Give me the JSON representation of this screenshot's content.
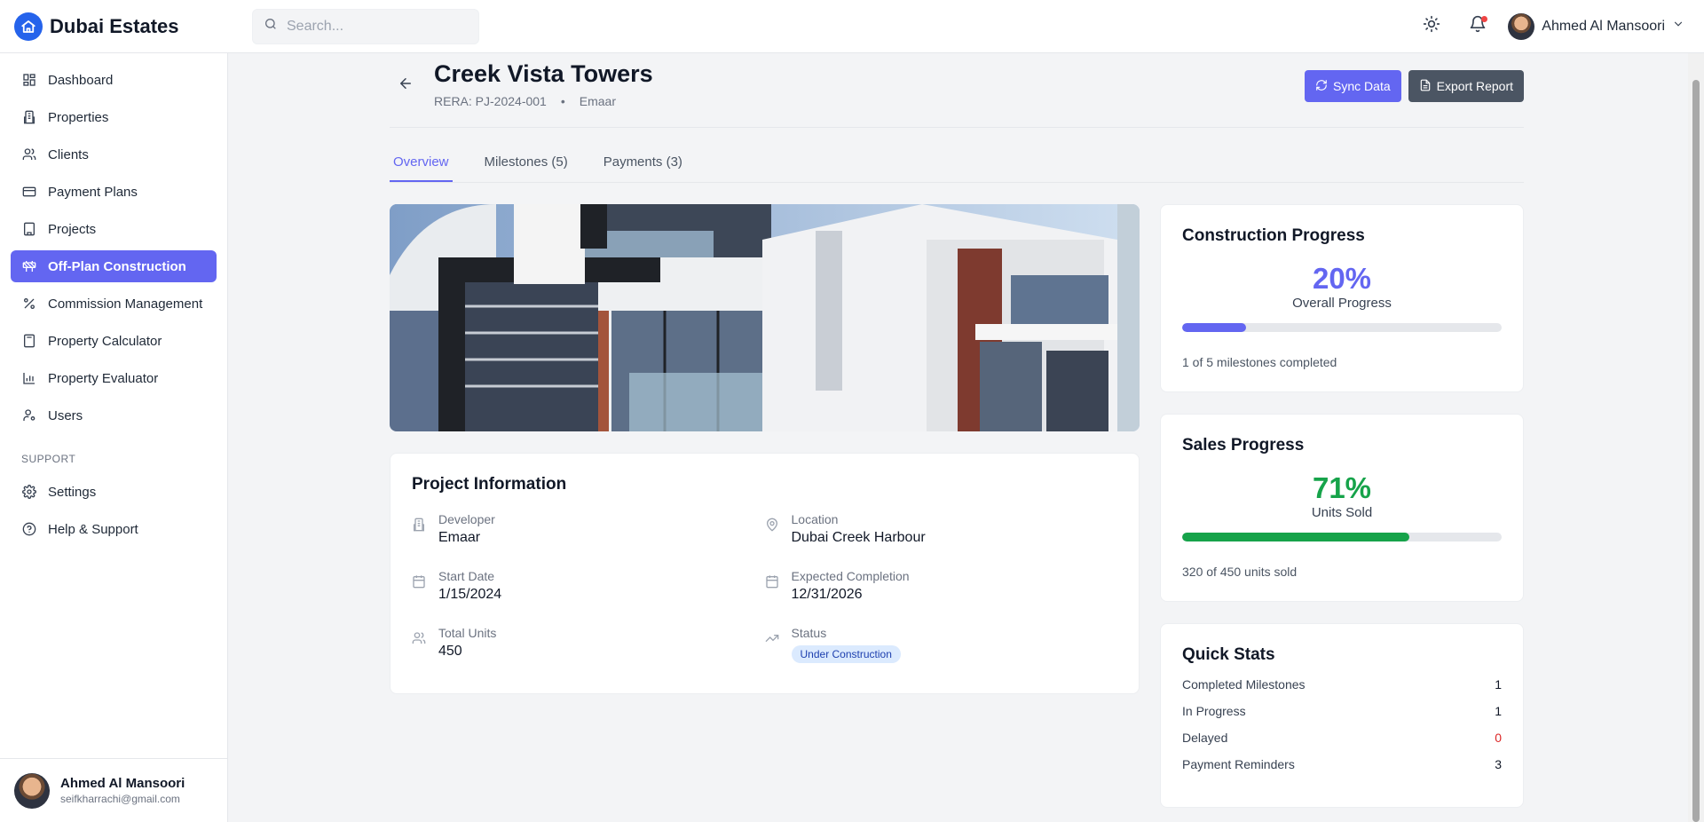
{
  "app": {
    "name": "Dubai Estates"
  },
  "header": {
    "search_placeholder": "Search...",
    "user_name": "Ahmed Al Mansoori"
  },
  "sidebar": {
    "items": [
      {
        "label": "Dashboard",
        "icon": "dashboard-icon"
      },
      {
        "label": "Properties",
        "icon": "building-icon"
      },
      {
        "label": "Clients",
        "icon": "users-icon"
      },
      {
        "label": "Payment Plans",
        "icon": "credit-card-icon"
      },
      {
        "label": "Projects",
        "icon": "office-icon"
      },
      {
        "label": "Off-Plan Construction",
        "icon": "construction-icon",
        "active": true
      },
      {
        "label": "Commission Management",
        "icon": "percent-icon"
      },
      {
        "label": "Property Calculator",
        "icon": "calculator-icon"
      },
      {
        "label": "Property Evaluator",
        "icon": "bar-chart-icon"
      },
      {
        "label": "Users",
        "icon": "user-key-icon"
      }
    ],
    "support_label": "SUPPORT",
    "support_items": [
      {
        "label": "Settings",
        "icon": "gear-icon"
      },
      {
        "label": "Help & Support",
        "icon": "help-icon"
      }
    ],
    "footer": {
      "name": "Ahmed Al Mansoori",
      "email": "seifkharrachi@gmail.com"
    }
  },
  "project": {
    "title": "Creek Vista Towers",
    "rera": "RERA: PJ-2024-001",
    "separator": "•",
    "developer_short": "Emaar",
    "actions": {
      "sync": "Sync Data",
      "export": "Export Report"
    }
  },
  "tabs": [
    {
      "label": "Overview",
      "active": true
    },
    {
      "label": "Milestones (5)"
    },
    {
      "label": "Payments (3)"
    }
  ],
  "info": {
    "title": "Project Information",
    "developer_label": "Developer",
    "developer": "Emaar",
    "location_label": "Location",
    "location": "Dubai Creek Harbour",
    "start_label": "Start Date",
    "start": "1/15/2024",
    "completion_label": "Expected Completion",
    "completion": "12/31/2026",
    "units_label": "Total Units",
    "units": "450",
    "status_label": "Status",
    "status": "Under Construction"
  },
  "construction": {
    "title": "Construction Progress",
    "percent_text": "20%",
    "percent": 20,
    "subtitle": "Overall Progress",
    "note": "1 of 5 milestones completed",
    "color": "#6366f1"
  },
  "sales": {
    "title": "Sales Progress",
    "percent_text": "71%",
    "percent": 71,
    "subtitle": "Units Sold",
    "note": "320 of 450 units sold",
    "color": "#16a34a"
  },
  "quick_stats": {
    "title": "Quick Stats",
    "rows": [
      {
        "label": "Completed Milestones",
        "value": "1"
      },
      {
        "label": "In Progress",
        "value": "1"
      },
      {
        "label": "Delayed",
        "value": "0",
        "color": "#dc2626"
      },
      {
        "label": "Payment Reminders",
        "value": "3"
      }
    ]
  }
}
